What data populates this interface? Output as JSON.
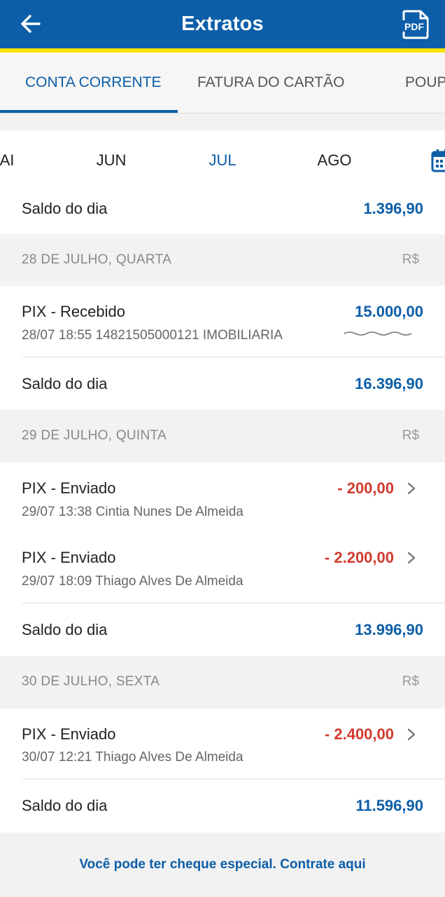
{
  "header": {
    "title": "Extratos",
    "back_icon": "arrow-left-icon",
    "pdf_icon": "pdf-file-icon",
    "pdf_text": "PDF"
  },
  "tabs": [
    {
      "label": "CONTA CORRENTE",
      "active": true
    },
    {
      "label": "FATURA DO CARTÃO",
      "active": false
    },
    {
      "label": "POUPA",
      "active": false
    }
  ],
  "months": [
    {
      "label": "AI"
    },
    {
      "label": "JUN"
    },
    {
      "label": "JUL",
      "active": true
    },
    {
      "label": "AGO"
    }
  ],
  "calendar_icon": "calendar-icon",
  "statement": {
    "top_balance": {
      "label": "Saldo do dia",
      "value": "1.396,90"
    },
    "days": [
      {
        "date": "28 DE JULHO, QUARTA",
        "currency": "R$",
        "transactions": [
          {
            "title": "PIX - Recebido",
            "detail": "28/07 18:55 14821505000121 IMOBILIARIA",
            "amount": "15.000,00",
            "type": "credit"
          }
        ],
        "balance": {
          "label": "Saldo do dia",
          "value": "16.396,90"
        }
      },
      {
        "date": "29 DE JULHO, QUINTA",
        "currency": "R$",
        "transactions": [
          {
            "title": "PIX - Enviado",
            "detail": "29/07 13:38 Cintia Nunes De Almeida",
            "amount": "- 200,00",
            "type": "debit"
          },
          {
            "title": "PIX - Enviado",
            "detail": "29/07 18:09 Thiago Alves De Almeida",
            "amount": "- 2.200,00",
            "type": "debit"
          }
        ],
        "balance": {
          "label": "Saldo do dia",
          "value": "13.996,90"
        }
      },
      {
        "date": "30 DE JULHO, SEXTA",
        "currency": "R$",
        "transactions": [
          {
            "title": "PIX - Enviado",
            "detail": "30/07 12:21 Thiago Alves De Almeida",
            "amount": "- 2.400,00",
            "type": "debit"
          }
        ],
        "balance": {
          "label": "Saldo do dia",
          "value": "11.596,90"
        }
      }
    ]
  },
  "footer": {
    "link_text": "Você pode ter cheque especial. Contrate aqui"
  },
  "colors": {
    "primary": "#0c5ea8",
    "accent_yellow": "#fce300",
    "debit_red": "#d23a2e"
  }
}
